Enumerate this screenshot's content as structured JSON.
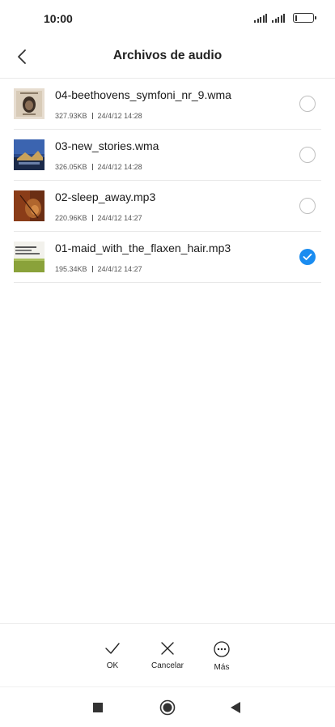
{
  "status_bar": {
    "time": "10:00",
    "icons": [
      "signal-icon",
      "signal-icon",
      "battery-icon"
    ]
  },
  "header": {
    "back_icon": "chevron-left-icon",
    "title": "Archivos de audio"
  },
  "files": [
    {
      "name": "04-beethovens_symfoni_nr_9.wma",
      "size": "327.93KB",
      "date": "24/4/12 14:28",
      "selected": false
    },
    {
      "name": "03-new_stories.wma",
      "size": "326.05KB",
      "date": "24/4/12 14:28",
      "selected": false
    },
    {
      "name": "02-sleep_away.mp3",
      "size": "220.96KB",
      "date": "24/4/12 14:27",
      "selected": false
    },
    {
      "name": "01-maid_with_the_flaxen_hair.mp3",
      "size": "195.34KB",
      "date": "24/4/12 14:27",
      "selected": true
    }
  ],
  "actions": {
    "ok": {
      "label": "OK",
      "icon": "check-icon"
    },
    "cancel": {
      "label": "Cancelar",
      "icon": "close-icon"
    },
    "more": {
      "label": "Más",
      "icon": "more-icon"
    }
  },
  "nav": {
    "recents_icon": "square-icon",
    "home_icon": "home-circle-icon",
    "back_icon": "triangle-back-icon"
  },
  "colors": {
    "accent": "#1a8cf0",
    "divider": "#e8e8e8",
    "text": "#1a1a1a"
  }
}
